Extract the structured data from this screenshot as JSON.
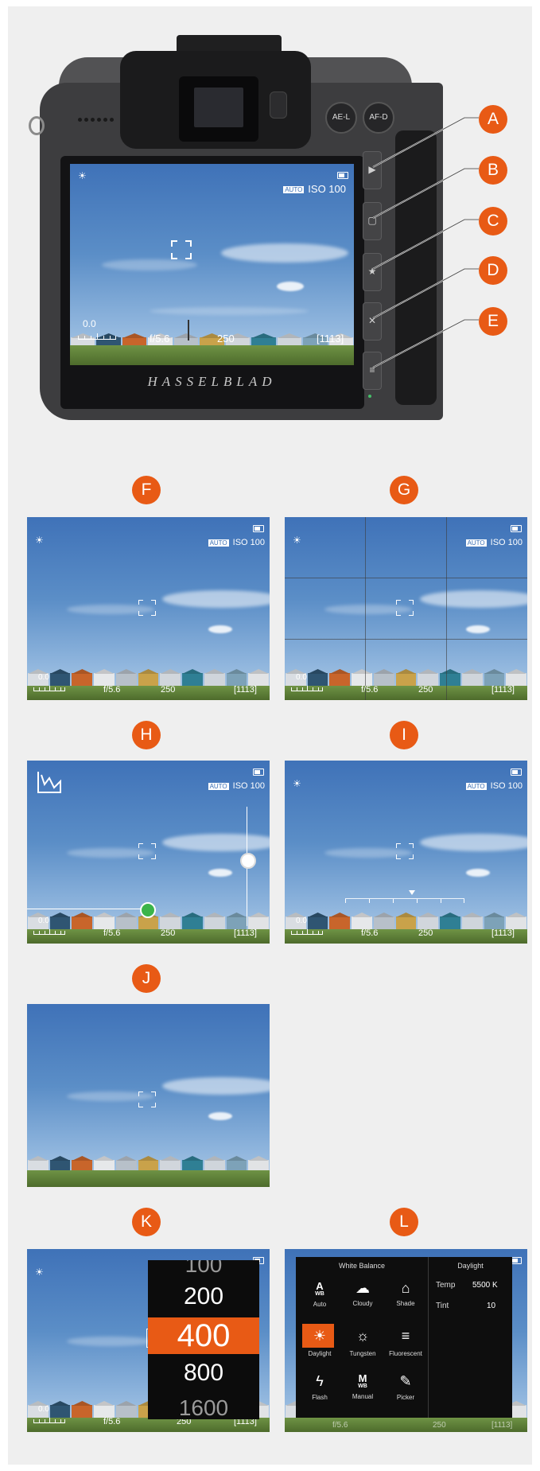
{
  "markers": {
    "a": "A",
    "b": "B",
    "c": "C",
    "d": "D",
    "e": "E",
    "f": "F",
    "g": "G",
    "h": "H",
    "i": "I",
    "j": "J",
    "k": "K",
    "l": "L"
  },
  "camera": {
    "btn_ae_l": "AE-L",
    "btn_af_d": "AF-D",
    "brand": "HASSELBLAD",
    "side_buttons": [
      "▶",
      "▢",
      "★",
      "✕",
      "≡"
    ]
  },
  "overlay": {
    "auto_badge": "AUTO",
    "iso": "ISO 100",
    "exposure_comp": "0.0",
    "aperture": "f/5.6",
    "shutter": "250",
    "shots": "[1113]"
  },
  "iso_picker": {
    "options": [
      "100",
      "200",
      "400",
      "800",
      "1600"
    ],
    "selected": "400"
  },
  "white_balance": {
    "title": "White Balance",
    "items": [
      {
        "label": "Auto",
        "icon": "auto-wb-icon",
        "glyph": "A"
      },
      {
        "label": "Cloudy",
        "icon": "cloud-icon",
        "glyph": "☁"
      },
      {
        "label": "Shade",
        "icon": "shade-icon",
        "glyph": "⌂"
      },
      {
        "label": "Daylight",
        "icon": "sun-icon",
        "glyph": "☀"
      },
      {
        "label": "Tungsten",
        "icon": "bulb-icon",
        "glyph": "☼"
      },
      {
        "label": "Fluorescent",
        "icon": "fluorescent-icon",
        "glyph": "≡"
      },
      {
        "label": "Flash",
        "icon": "flash-icon",
        "glyph": "ϟ"
      },
      {
        "label": "Manual",
        "icon": "manual-wb-icon",
        "glyph": "M"
      },
      {
        "label": "Picker",
        "icon": "eyedropper-icon",
        "glyph": "✎"
      }
    ],
    "selected": "Daylight",
    "detail_title": "Daylight",
    "temp_label": "Temp",
    "temp_value": "5500 K",
    "tint_label": "Tint",
    "tint_value": "10"
  },
  "colors": {
    "accent": "#e85a15",
    "sky": "#4f86c4",
    "grass": "#5e7f37"
  }
}
